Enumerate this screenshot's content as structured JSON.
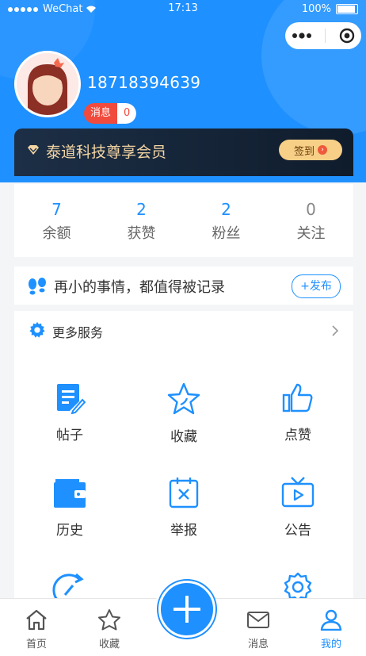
{
  "status_bar": {
    "carrier": "WeChat",
    "time": "17:13",
    "battery": "100%"
  },
  "profile": {
    "phone": "18718394639",
    "msg_label": "消息",
    "msg_count": "0"
  },
  "vip": {
    "title": "泰道科技尊享会员",
    "sign_label": "签到"
  },
  "stats": [
    {
      "value": "7",
      "label": "余额"
    },
    {
      "value": "2",
      "label": "获赞"
    },
    {
      "value": "2",
      "label": "粉丝"
    },
    {
      "value": "0",
      "label": "关注"
    }
  ],
  "publish": {
    "text": "再小的事情，都值得被记录",
    "button": "+发布"
  },
  "services": {
    "title": "更多服务",
    "items": [
      {
        "label": "帖子",
        "icon": "post-icon"
      },
      {
        "label": "收藏",
        "icon": "star-icon"
      },
      {
        "label": "点赞",
        "icon": "thumb-up-icon"
      },
      {
        "label": "历史",
        "icon": "wallet-icon"
      },
      {
        "label": "举报",
        "icon": "report-icon"
      },
      {
        "label": "公告",
        "icon": "tv-icon"
      },
      {
        "label": "",
        "icon": "refresh-icon"
      },
      {
        "label": "",
        "icon": "settings-icon"
      }
    ]
  },
  "tabbar": [
    {
      "label": "首页",
      "icon": "home-icon"
    },
    {
      "label": "收藏",
      "icon": "star-icon"
    },
    {
      "label": "消息",
      "icon": "mail-icon"
    },
    {
      "label": "我的",
      "icon": "user-icon"
    }
  ],
  "colors": {
    "accent": "#1e90ff",
    "badge": "#f04b3d",
    "vip_text": "#f3d5a3"
  }
}
